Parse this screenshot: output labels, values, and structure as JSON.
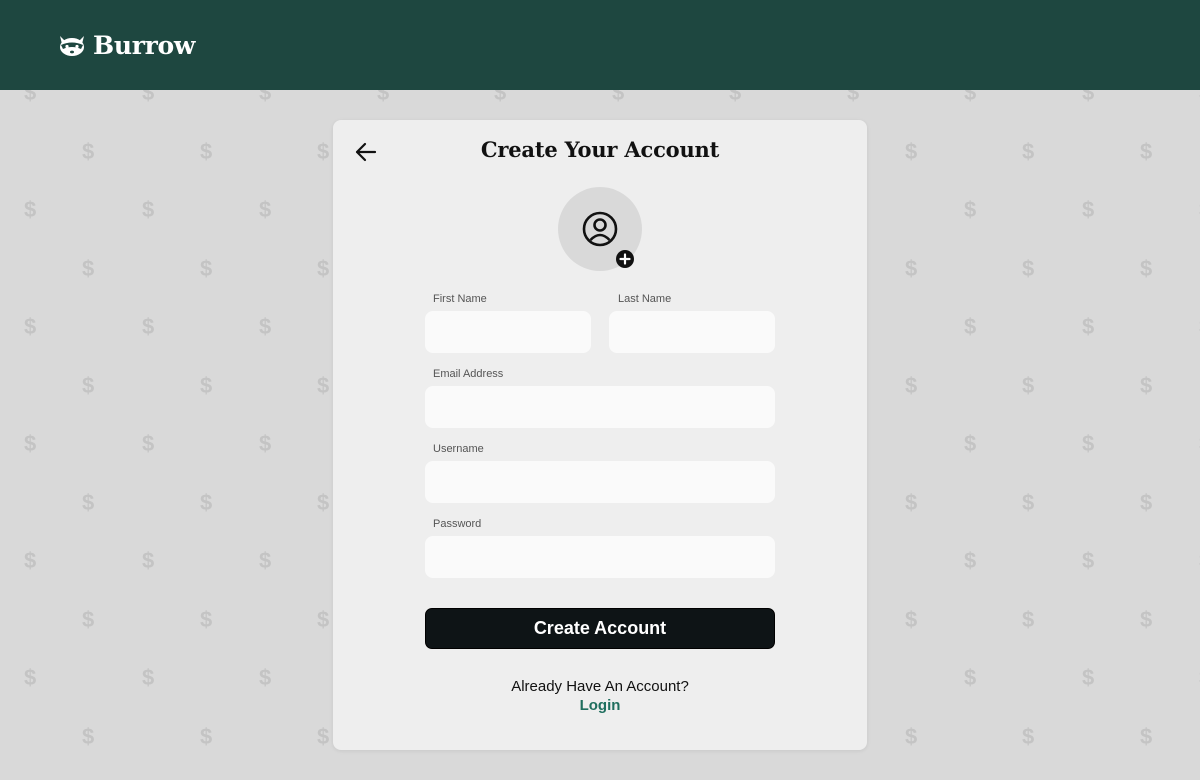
{
  "header": {
    "brand_name": "Burrow",
    "logo_icon": "raccoon-icon",
    "background_color": "#1e4740"
  },
  "background": {
    "pattern_glyph": "$"
  },
  "form": {
    "title": "Create Your Account",
    "back_icon": "arrow-left-icon",
    "avatar_icon": "user-circle-icon",
    "avatar_add_icon": "plus-circle-icon",
    "fields": {
      "first_name": {
        "label": "First Name",
        "value": ""
      },
      "last_name": {
        "label": "Last Name",
        "value": ""
      },
      "email": {
        "label": "Email Address",
        "value": ""
      },
      "username": {
        "label": "Username",
        "value": ""
      },
      "password": {
        "label": "Password",
        "value": ""
      }
    },
    "submit_label": "Create Account",
    "login_prompt": "Already Have An Account?",
    "login_label": "Login",
    "accent_color": "#1f6e5e"
  }
}
